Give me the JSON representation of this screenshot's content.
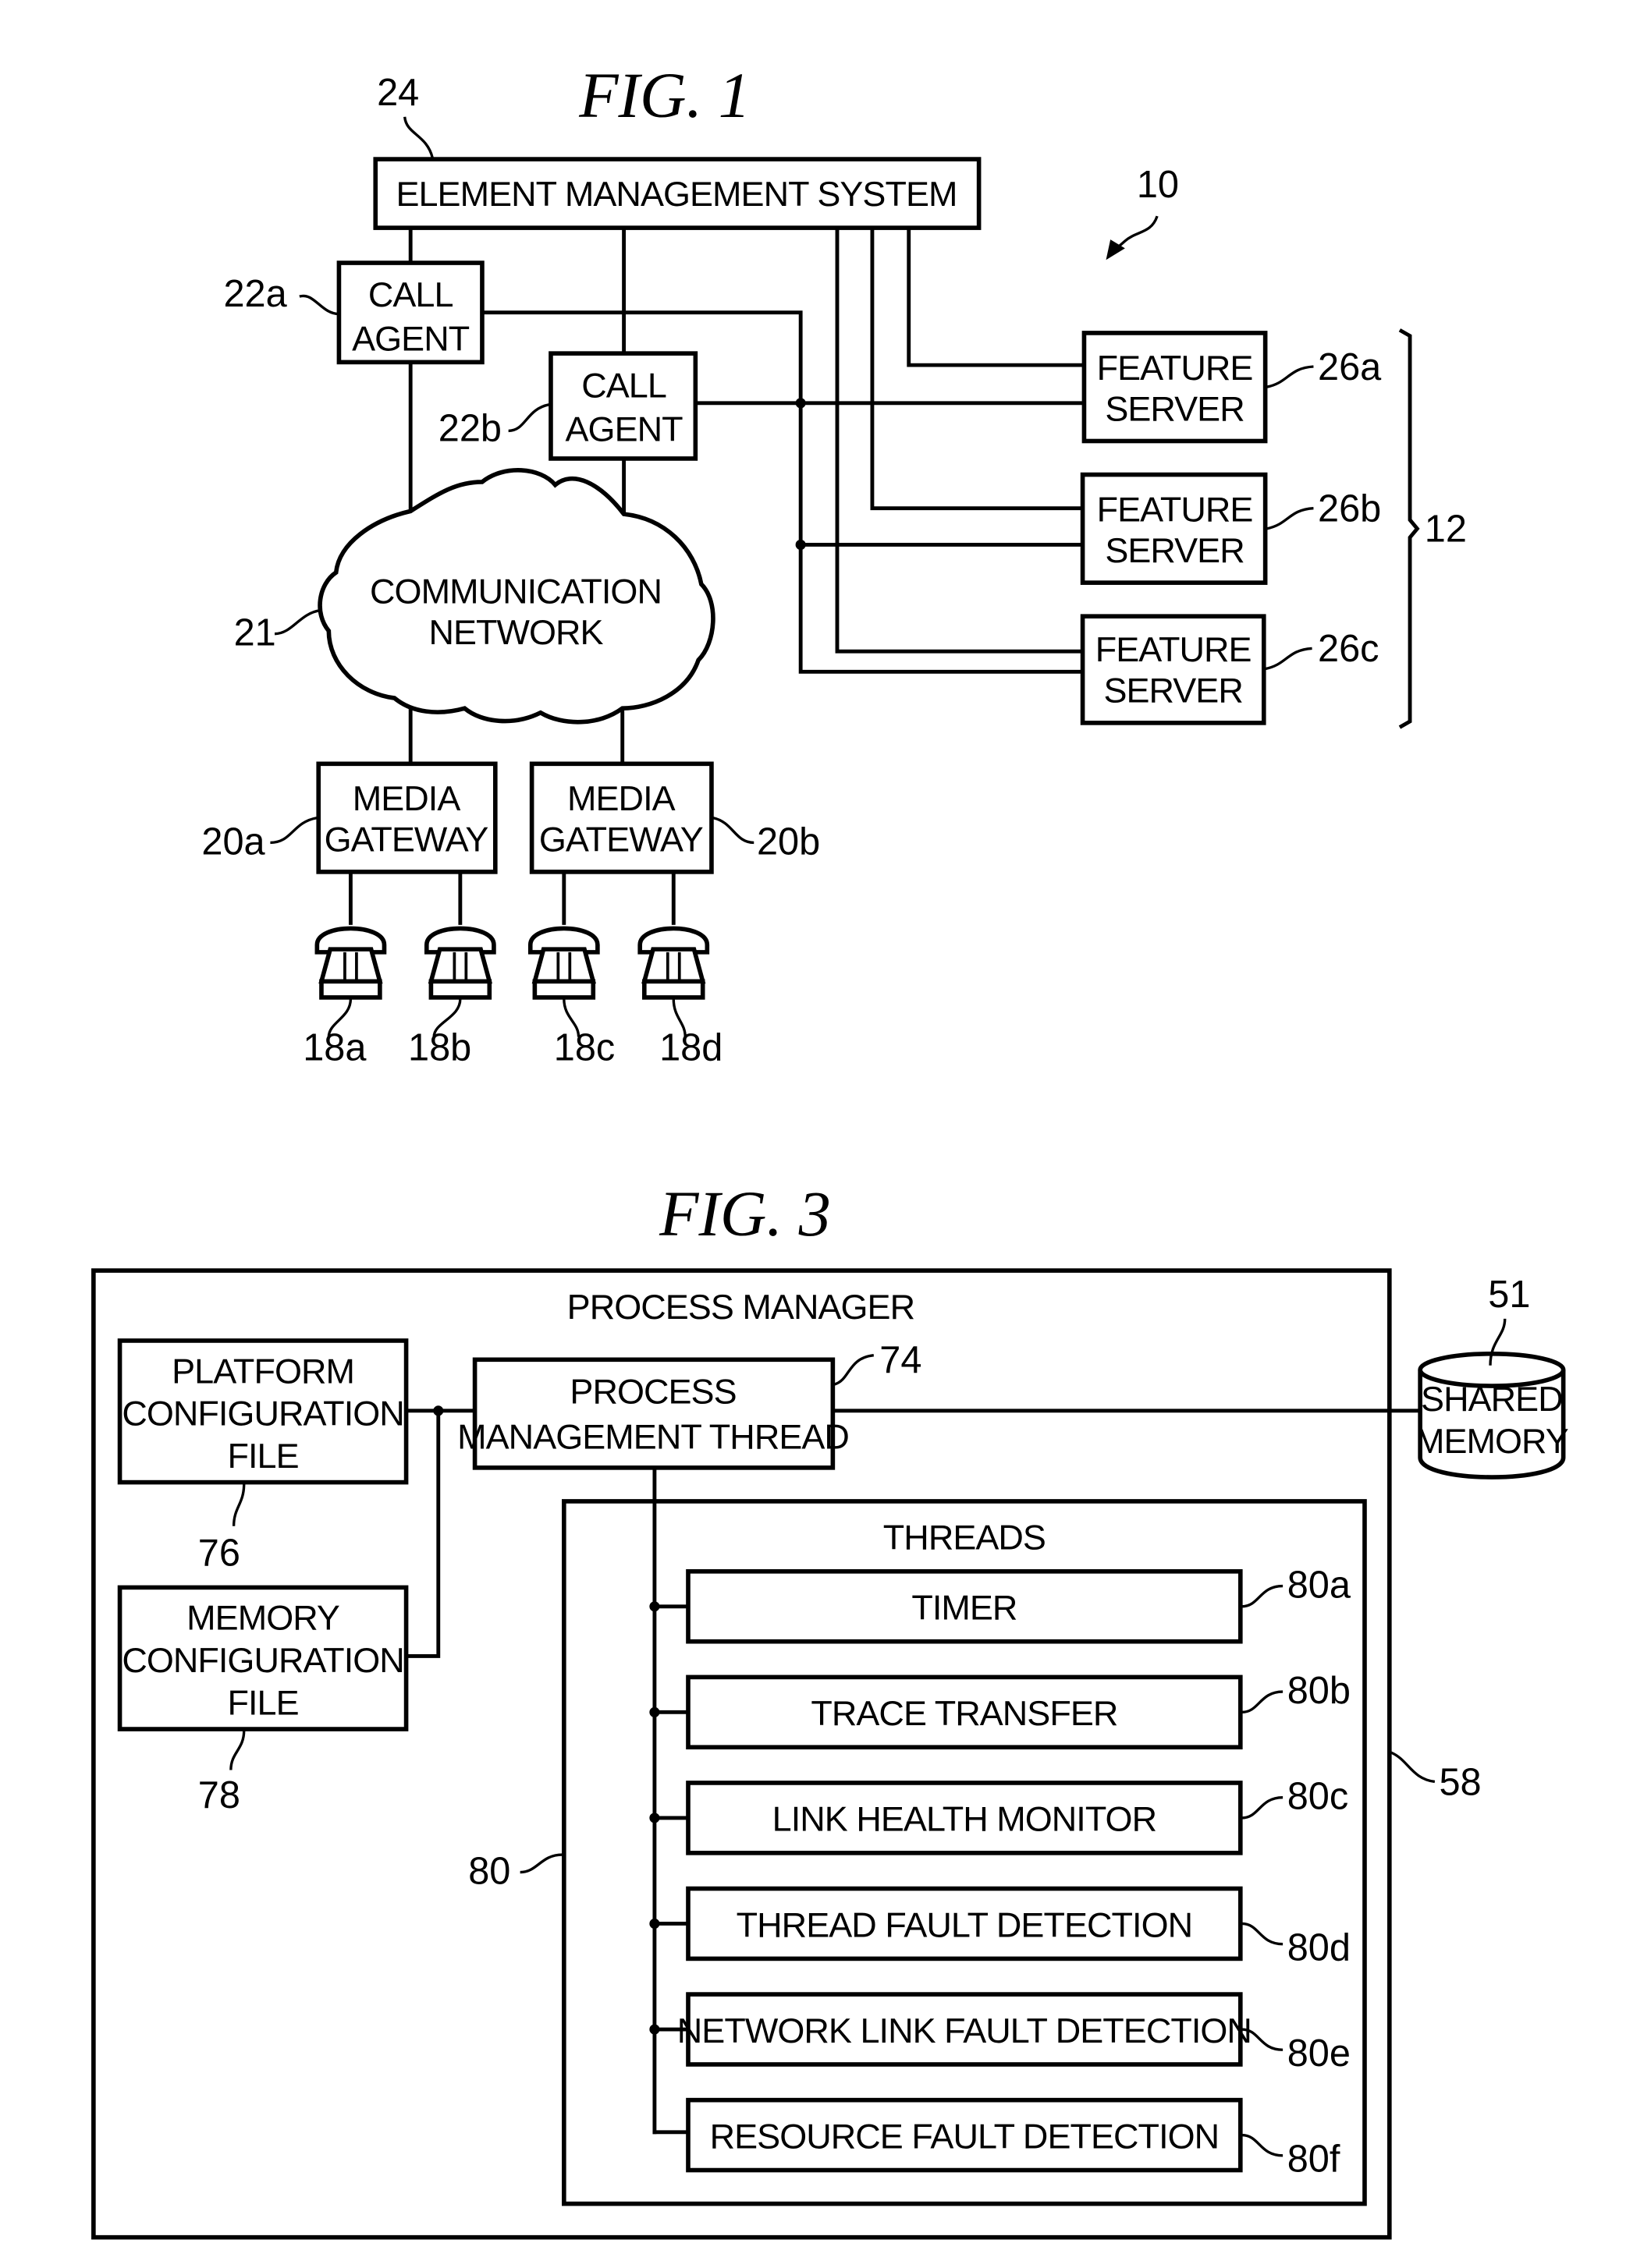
{
  "fig1": {
    "title": "FIG. 1",
    "system_ref": "10",
    "ems": {
      "label": "ELEMENT MANAGEMENT SYSTEM",
      "ref": "24"
    },
    "call_agents": [
      {
        "line1": "CALL",
        "line2": "AGENT",
        "ref": "22a"
      },
      {
        "line1": "CALL",
        "line2": "AGENT",
        "ref": "22b"
      }
    ],
    "network": {
      "line1": "COMMUNICATION",
      "line2": "NETWORK",
      "ref": "21"
    },
    "media_gateways": [
      {
        "line1": "MEDIA",
        "line2": "GATEWAY",
        "ref": "20a"
      },
      {
        "line1": "MEDIA",
        "line2": "GATEWAY",
        "ref": "20b"
      }
    ],
    "phones": [
      {
        "ref": "18a"
      },
      {
        "ref": "18b"
      },
      {
        "ref": "18c"
      },
      {
        "ref": "18d"
      }
    ],
    "feature_servers": [
      {
        "line1": "FEATURE",
        "line2": "SERVER",
        "ref": "26a"
      },
      {
        "line1": "FEATURE",
        "line2": "SERVER",
        "ref": "26b"
      },
      {
        "line1": "FEATURE",
        "line2": "SERVER",
        "ref": "26c"
      }
    ],
    "feature_group_ref": "12"
  },
  "fig3": {
    "title": "FIG. 3",
    "process_manager": {
      "label": "PROCESS MANAGER",
      "ref": "58"
    },
    "platform_config": {
      "line1": "PLATFORM",
      "line2": "CONFIGURATION",
      "line3": "FILE",
      "ref": "76"
    },
    "memory_config": {
      "line1": "MEMORY",
      "line2": "CONFIGURATION",
      "line3": "FILE",
      "ref": "78"
    },
    "pm_thread": {
      "line1": "PROCESS",
      "line2": "MANAGEMENT THREAD",
      "ref": "74"
    },
    "shared_memory": {
      "line1": "SHARED",
      "line2": "MEMORY",
      "ref": "51"
    },
    "threads": {
      "label": "THREADS",
      "ref": "80",
      "items": [
        {
          "label": "TIMER",
          "ref": "80a"
        },
        {
          "label": "TRACE TRANSFER",
          "ref": "80b"
        },
        {
          "label": "LINK HEALTH MONITOR",
          "ref": "80c"
        },
        {
          "label": "THREAD FAULT DETECTION",
          "ref": "80d"
        },
        {
          "label": "NETWORK LINK FAULT DETECTION",
          "ref": "80e"
        },
        {
          "label": "RESOURCE FAULT DETECTION",
          "ref": "80f"
        }
      ]
    }
  }
}
